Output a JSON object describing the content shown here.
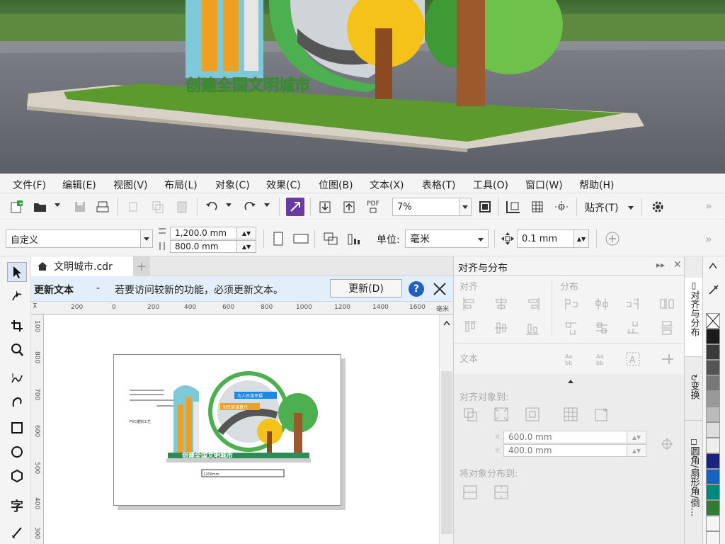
{
  "menu": [
    "文件(F)",
    "编辑(E)",
    "视图(V)",
    "布局(L)",
    "对象(C)",
    "效果(C)",
    "位图(B)",
    "文本(X)",
    "表格(T)",
    "工具(O)",
    "窗口(W)",
    "帮助(H)"
  ],
  "toolbar": {
    "zoom": "7%",
    "paste_label": "贴齐(T)",
    "pdf_label": "PDF"
  },
  "property_bar": {
    "page_size": "自定义",
    "width": "1,200.0 mm",
    "height": "800.0 mm",
    "unit_label": "单位:",
    "unit_value": "毫米",
    "nudge": "0.1 mm"
  },
  "doc_tab": "文明城市.cdr",
  "notice": {
    "title": "更新文本",
    "dash": "-",
    "message": "若要访问较新的功能，必须更新文本。",
    "button": "更新(D)"
  },
  "ruler": {
    "ticks": [
      "200",
      "0",
      "200",
      "400",
      "600",
      "800",
      "1000",
      "1200",
      "1400",
      "1600"
    ],
    "unit": "毫米",
    "vticks": [
      "100",
      "800",
      "700",
      "600",
      "500",
      "400",
      "300"
    ]
  },
  "docker": {
    "title": "对齐与分布",
    "align_label": "对齐",
    "distribute_label": "分布",
    "text_label": "文本",
    "align_to_label": "对齐对象到:",
    "x_value": "600.0 mm",
    "y_value": "400.0 mm",
    "x_label": "X:",
    "y_label": "Y:",
    "distribute_to_label": "将对象分布到:"
  },
  "docker_tabs": [
    "对齐与分布",
    "变换",
    "圆角/扇形角/倒..."
  ],
  "sign_text": "创建全国文明城市",
  "art_labels": [
    "为人民谋幸福",
    "为民族谋复兴"
  ],
  "art_dims": "1200mm",
  "art_material": "PVC雕刻工艺",
  "palette_colors": [
    "#ffffff",
    "#1a1a1a",
    "#3a3a3a",
    "#555555",
    "#777777",
    "#999999",
    "#bbbbbb",
    "#dddddd",
    "#eeeeee",
    "#1a237e",
    "#1565c0",
    "#00897b",
    "#2e7d32"
  ]
}
